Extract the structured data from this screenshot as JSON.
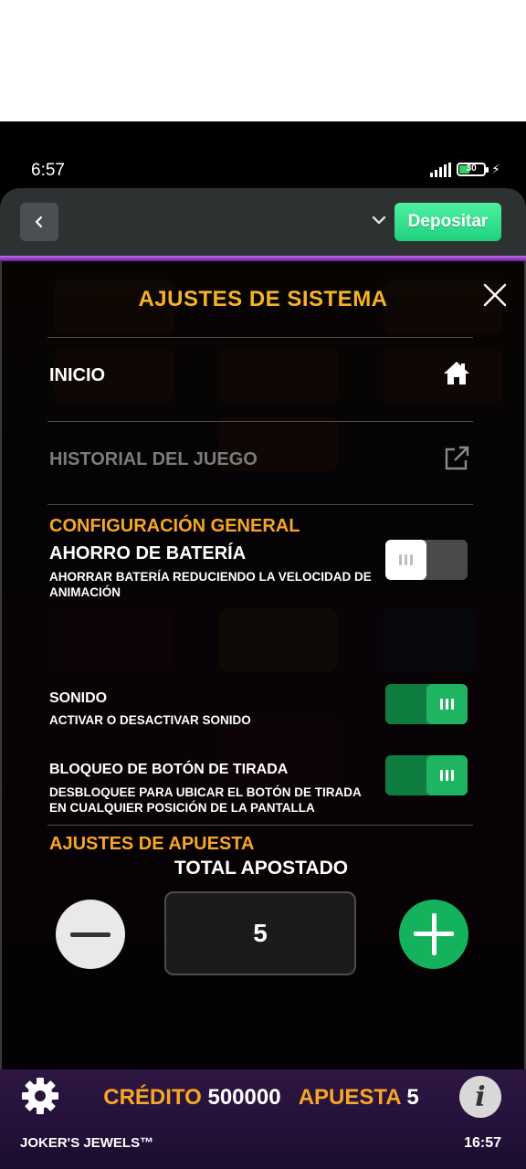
{
  "status_bar": {
    "time": "6:57",
    "battery": "30"
  },
  "header": {
    "deposit_label": "Depositar"
  },
  "panel": {
    "title": "AJUSTES DE SISTEMA",
    "inicio": "INICIO",
    "history": "HISTORIAL DEL JUEGO",
    "general_section": "CONFIGURACIÓN GENERAL",
    "battery_saver": {
      "title": "AHORRO DE BATERÍA",
      "desc": "AHORRAR BATERÍA REDUCIENDO LA VELOCIDAD DE ANIMACIÓN",
      "on": false
    },
    "sound": {
      "title": "SONIDO",
      "desc": "ACTIVAR O DESACTIVAR SONIDO",
      "on": true
    },
    "spin_lock": {
      "title": "BLOQUEO DE BOTÓN DE TIRADA",
      "desc": "DESBLOQUEE PARA UBICAR EL BOTÓN DE TIRADA EN CUALQUIER POSICIÓN DE LA PANTALLA",
      "on": true
    },
    "bet_section": "AJUSTES DE APUESTA",
    "total_label": "TOTAL APOSTADO",
    "total_value": "5"
  },
  "footer": {
    "credit_label": "CRÉDITO",
    "credit_value": "500000",
    "bet_label": "APUESTA",
    "bet_value": "5",
    "game_name": "JOKER'S JEWELS™",
    "time": "16:57"
  },
  "colors": {
    "accent": "#f7a625",
    "toggle_on": "#1fb461",
    "deposit": "#2fdc8a",
    "plus": "#14b25c"
  }
}
